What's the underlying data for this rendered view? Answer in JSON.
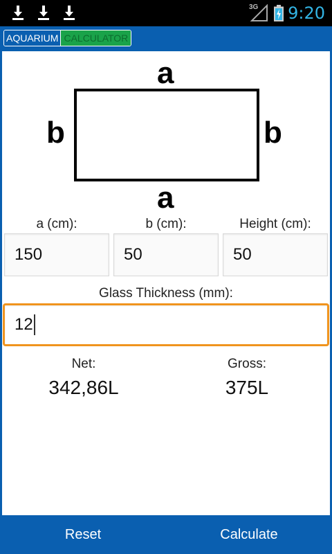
{
  "status_bar": {
    "notifications": [
      "download-icon",
      "download-icon",
      "download-icon"
    ],
    "network_type": "3G",
    "time": "9:20"
  },
  "app": {
    "logo_part1": "AQUARIUM",
    "logo_part2": "CALCULATOR"
  },
  "diagram": {
    "top_label": "a",
    "bottom_label": "a",
    "left_label": "b",
    "right_label": "b"
  },
  "inputs": {
    "a": {
      "label": "a (cm):",
      "value": "150"
    },
    "b": {
      "label": "b (cm):",
      "value": "50"
    },
    "height": {
      "label": "Height (cm):",
      "value": "50"
    },
    "glass": {
      "label": "Glass Thickness (mm):",
      "value": "12"
    }
  },
  "results": {
    "net_label": "Net:",
    "net_value": "342,86L",
    "gross_label": "Gross:",
    "gross_value": "375L"
  },
  "actions": {
    "reset": "Reset",
    "calculate": "Calculate"
  },
  "colors": {
    "primary": "#0a5fb0",
    "focus": "#f0941e",
    "logo_green": "#1aa34a",
    "clock": "#33b5e5"
  }
}
